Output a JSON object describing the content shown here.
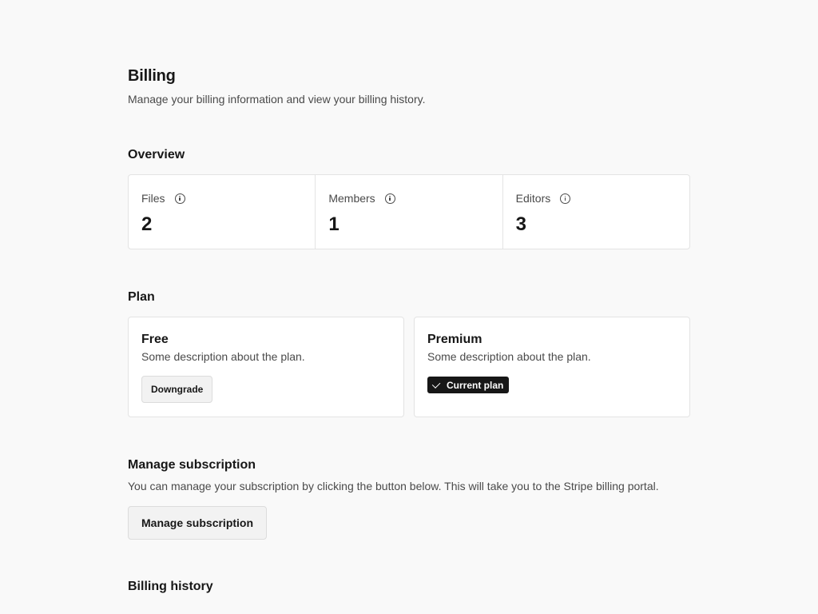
{
  "header": {
    "title": "Billing",
    "subtitle": "Manage your billing information and view your billing history."
  },
  "overview": {
    "heading": "Overview",
    "stats": [
      {
        "label": "Files",
        "value": "2",
        "icon": "info-icon"
      },
      {
        "label": "Members",
        "value": "1",
        "icon": "info-icon"
      },
      {
        "label": "Editors",
        "value": "3",
        "icon": "info-icon"
      }
    ]
  },
  "plan": {
    "heading": "Plan",
    "plans": [
      {
        "name": "Free",
        "description": "Some description about the plan.",
        "action_label": "Downgrade"
      },
      {
        "name": "Premium",
        "description": "Some description about the plan.",
        "badge_label": "Current plan",
        "badge_icon": "check-icon"
      }
    ]
  },
  "manage": {
    "heading": "Manage subscription",
    "description": "You can manage your subscription by clicking the button below. This will take you to the Stripe billing portal.",
    "button_label": "Manage subscription"
  },
  "history": {
    "heading": "Billing history"
  },
  "colors": {
    "background": "#f9f9f9",
    "card": "#ffffff",
    "border": "#e3e3e3",
    "text": "#171717",
    "muted_text": "#4a4a4a",
    "badge_bg": "#171717"
  }
}
